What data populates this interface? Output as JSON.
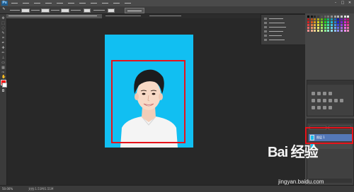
{
  "app": {
    "logo_text": "Ps",
    "menu_count": 11
  },
  "window_controls": [
    "–",
    "□",
    "✕"
  ],
  "options_bar": {
    "adjust_edge_label": ""
  },
  "document_tabs": [
    {
      "label": "",
      "active": true
    },
    {
      "label": "",
      "active": false
    },
    {
      "label": "",
      "active": false
    }
  ],
  "history_panel": {
    "rows": [
      "",
      "",
      "",
      "",
      "",
      ""
    ]
  },
  "layers_panel": {
    "layer_name": "图层 1"
  },
  "status_bar": {
    "zoom": "50.00%",
    "doc_info": "文档:1.51M/1.51M"
  },
  "watermark": {
    "line1": "Bai 经验",
    "line2": "jingyan.baidu.com"
  },
  "colors": {
    "photo_background": "#11bff2",
    "highlight_box": "#e8131b",
    "foreground_color": "#ff0000",
    "background_color": "#ffffff",
    "selected_layer": "#5478b8"
  }
}
